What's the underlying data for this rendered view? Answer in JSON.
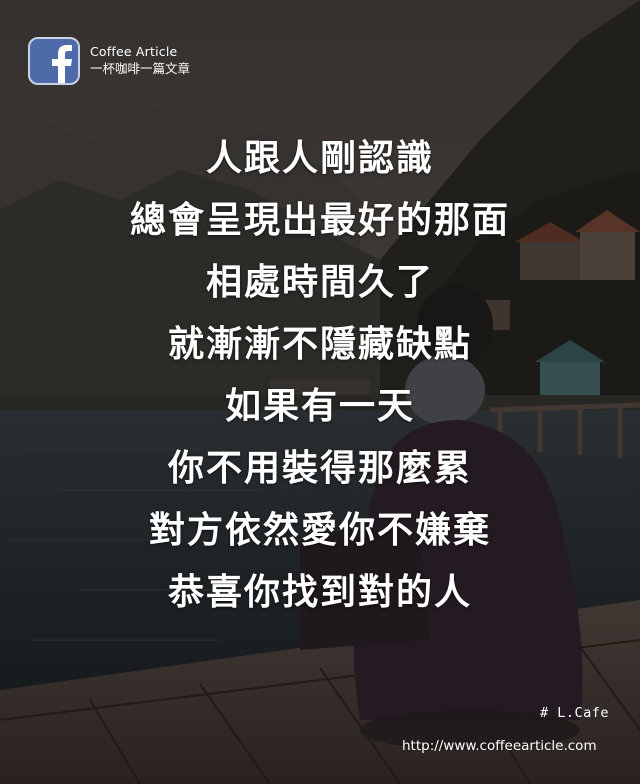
{
  "brand": {
    "name_en": "Coffee Article",
    "name_zh": "一杯咖啡一篇文章",
    "logo_icon": "facebook-icon"
  },
  "poem": {
    "lines": [
      "人跟人剛認識",
      "總會呈現出最好的那面",
      "相處時間久了",
      "就漸漸不隱藏缺點",
      "如果有一天",
      "你不用裝得那麼累",
      "對方依然愛你不嫌棄",
      "恭喜你找到對的人"
    ]
  },
  "footer": {
    "hashtag": "# L.Cafe",
    "url": "http://www.coffeearticle.com"
  },
  "colors": {
    "text": "#ffffff",
    "facebook_blue": "#4e6aa8",
    "sky": "#5a524e",
    "water": "#2c3236",
    "deck": "#4a403c"
  }
}
